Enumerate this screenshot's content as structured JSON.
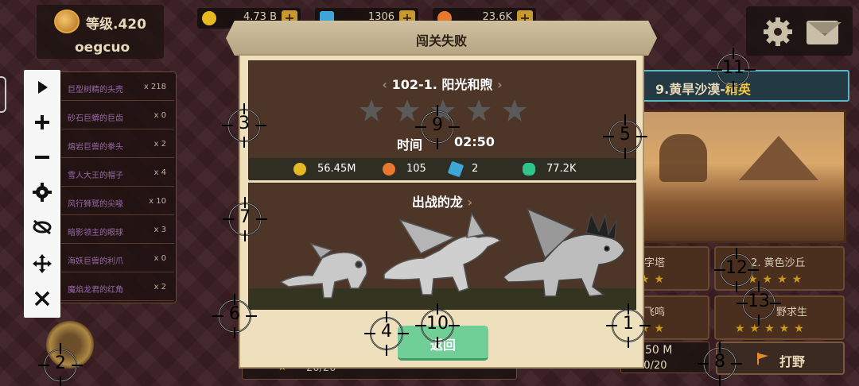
{
  "profile": {
    "level": "等级.420",
    "username": "oegcuo"
  },
  "resources": [
    {
      "icon": "gold-coin-icon",
      "value": "4.73 B",
      "color": "#e5b824"
    },
    {
      "icon": "gem-icon",
      "value": "1306",
      "color": "#3fa6d8"
    },
    {
      "icon": "fire-orb-icon",
      "value": "23.6K",
      "color": "#e8782b"
    }
  ],
  "quests": [
    {
      "name": "巨型树精的头壳",
      "count": "x 218"
    },
    {
      "name": "砂石巨蟒的巨齿",
      "count": "x 0"
    },
    {
      "name": "熔岩巨兽的拳头",
      "count": "x 2"
    },
    {
      "name": "雪人大王的帽子",
      "count": "x 4"
    },
    {
      "name": "风行狮鹫的尖喙",
      "count": "x 10"
    },
    {
      "name": "暗影领主的眼球",
      "count": "x 3"
    },
    {
      "name": "海妖巨兽的利爪",
      "count": "x 0"
    },
    {
      "name": "魔焰龙君的红角",
      "count": "x 2"
    }
  ],
  "toolbar": [
    "play-icon",
    "zoom-in-icon",
    "zoom-out-icon",
    "settings-icon",
    "hide-icon",
    "move-icon",
    "close-icon"
  ],
  "right": {
    "stage_title": "9.黄旱沙漠-",
    "stage_tier": "精英",
    "substages": [
      {
        "name": "字塔"
      },
      {
        "name": "2. 黄色沙丘"
      },
      {
        "name": "飞鸣"
      },
      {
        "name": "野求生"
      }
    ],
    "bottom_left_value": "50 M",
    "bottom_left_progress": "20/20",
    "button": "打野"
  },
  "bottom_left_progress": "20/20",
  "modal": {
    "title": "闯关失败",
    "stage_name": "102-1. 阳光和煦",
    "stars_total": 5,
    "stars_earned": 0,
    "time_label": "时间",
    "time_value": "02:50",
    "rewards": [
      {
        "icon": "gold-coin-icon",
        "value": "56.45M"
      },
      {
        "icon": "fire-orb-icon",
        "value": "105"
      },
      {
        "icon": "gem-icon",
        "value": "2"
      },
      {
        "icon": "green-crystal-icon",
        "value": "77.2K"
      }
    ],
    "dragons_title": "出战的龙",
    "return_button": "返回"
  },
  "markers": [
    "1",
    "2",
    "3",
    "4",
    "5",
    "6",
    "7",
    "8",
    "9",
    "10",
    "11",
    "12",
    "13"
  ]
}
